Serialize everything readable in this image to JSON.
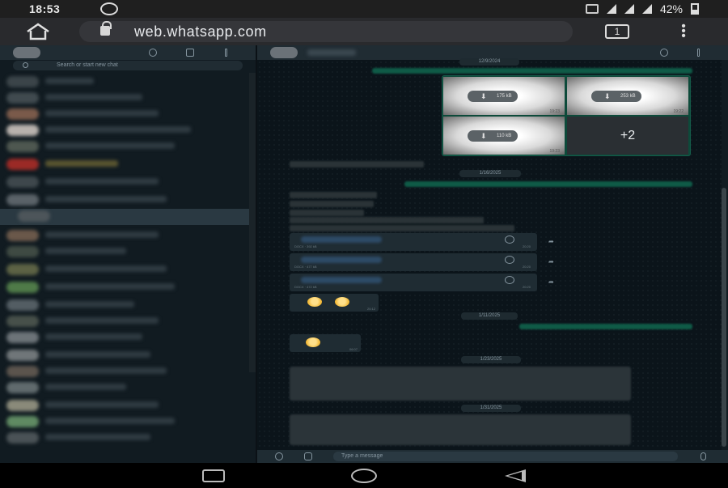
{
  "status_bar": {
    "time": "18:53",
    "battery": "42%",
    "icons": [
      "whatsapp-icon",
      "vibrate-icon",
      "wifi-icon",
      "signal-icon",
      "signal-icon",
      "battery-icon"
    ]
  },
  "browser": {
    "url": "web.whatsapp.com",
    "tab_count": "1",
    "icons": [
      "home-icon",
      "lock-icon",
      "tabs-icon",
      "menu-icon"
    ]
  },
  "sidebar": {
    "search_placeholder": "Search or start new chat",
    "header_icons": [
      "status-icon",
      "new-chat-icon",
      "menu-icon"
    ]
  },
  "conversation": {
    "date_labels": [
      "12/9/2024",
      "1/16/2025",
      "1/11/2025",
      "1/23/2025",
      "1/31/2025"
    ],
    "media": [
      {
        "size": "175 kB",
        "time": "19:23"
      },
      {
        "size": "253 kB",
        "time": "19:22"
      },
      {
        "size": "110 kB",
        "time": "19:23"
      }
    ],
    "more_media": "+2",
    "documents": [
      {
        "meta": "DOCX · 392 kB",
        "time": "20:20"
      },
      {
        "meta": "DOCX · 477 kB",
        "time": "20:20"
      },
      {
        "meta": "DOCX · 472 kB",
        "time": "20:20"
      }
    ],
    "emoji_times": [
      "20:12",
      "06:07"
    ],
    "composer_placeholder": "Type a message"
  },
  "colors": {
    "panel": "#202c33",
    "background": "#0b141a",
    "outgoing": "#0f5a47",
    "incoming": "#1f2c33"
  }
}
